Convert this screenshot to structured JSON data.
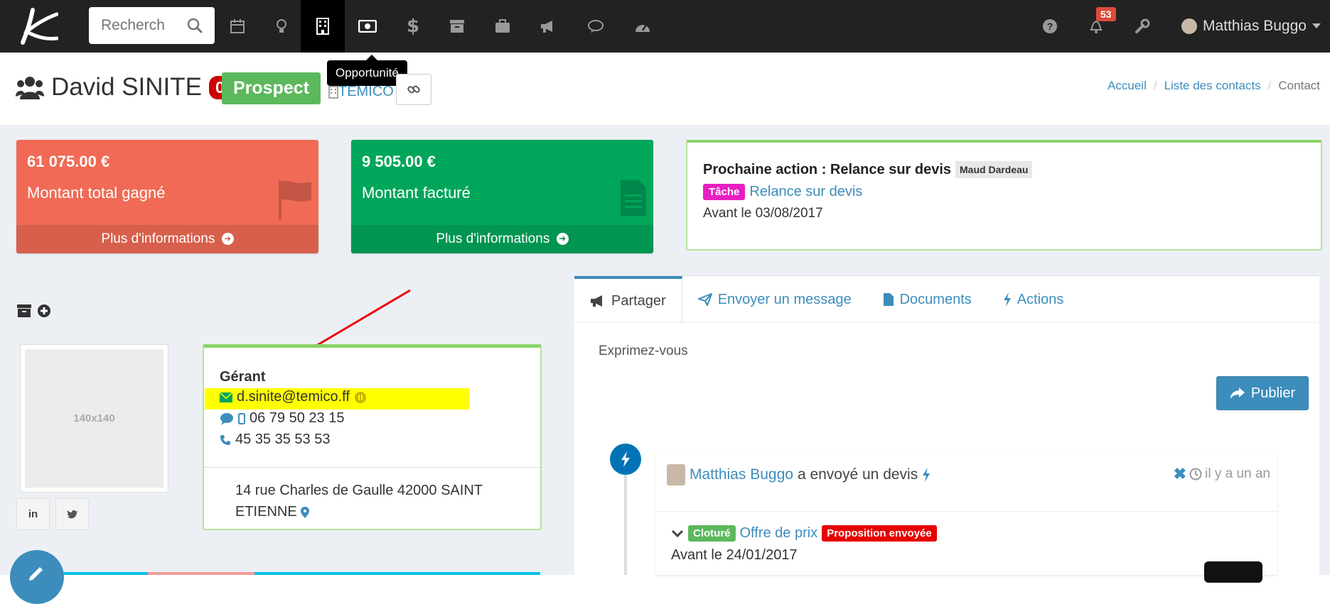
{
  "navbar": {
    "search_placeholder": "Recherch",
    "notifications_count": "53",
    "user_name": "Matthias Buggo",
    "icons": [
      "calendar-icon",
      "lightbulb-icon",
      "building-icon",
      "money-icon",
      "dollar-icon",
      "archive-icon",
      "briefcase-icon",
      "bullhorn-icon",
      "comments-icon",
      "dashboard-icon"
    ],
    "right_icons": [
      "question-icon",
      "bell-icon",
      "wrench-icon"
    ]
  },
  "tooltip": "Opportunité",
  "header": {
    "name": "David SINITE",
    "count": "0",
    "status": "Prospect",
    "company": "TEMICO"
  },
  "breadcrumb": {
    "home": "Accueil",
    "list": "Liste des contacts",
    "current": "Contact"
  },
  "boxes": {
    "won": {
      "value": "61 075.00 €",
      "label": "Montant total gagné",
      "more": "Plus d'informations",
      "color": "#f06a55"
    },
    "billed": {
      "value": "9 505.00 €",
      "label": "Montant facturé",
      "more": "Plus d'informations",
      "color": "#00a65a"
    }
  },
  "next_action": {
    "title": "Prochaine action : Relance sur devis",
    "assignee": "Maud Dardeau",
    "type_tag": "Tâche",
    "link": "Relance sur devis",
    "deadline": "Avant le 03/08/2017"
  },
  "photo_placeholder": "140x140",
  "social": {
    "linkedin": "in",
    "twitter": "twitter"
  },
  "contact": {
    "role": "Gérant",
    "email": "d.sinite@temico.ff",
    "mobile": "06 79 50 23 15",
    "phone": "45 35 35 53 53",
    "address": "14 rue Charles de Gaulle 42000 SAINT ETIENNE"
  },
  "tabs": {
    "share": "Partager",
    "message": "Envoyer un message",
    "documents": "Documents",
    "actions": "Actions",
    "placeholder": "Exprimez-vous",
    "publish": "Publier"
  },
  "timeline": {
    "author": "Matthias Buggo",
    "verb": "a envoyé un devis",
    "time": "il y a un an",
    "closed_tag": "Cloturé",
    "offer_link": "Offre de prix",
    "status_tag": "Proposition envoyée",
    "deadline": "Avant le 24/01/2017"
  }
}
